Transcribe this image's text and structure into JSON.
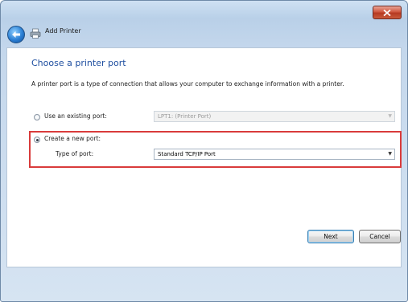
{
  "window": {
    "title": "Add Printer"
  },
  "page": {
    "heading": "Choose a printer port",
    "description": "A printer port is a type of connection that allows your computer to exchange information with a printer."
  },
  "options": {
    "existing": {
      "label": "Use an existing port:",
      "selected": false,
      "value": "LPT1: (Printer Port)"
    },
    "new_port": {
      "label": "Create a new port:",
      "selected": true,
      "type_label": "Type of port:",
      "type_value": "Standard TCP/IP Port"
    }
  },
  "buttons": {
    "next": "Next",
    "cancel": "Cancel"
  },
  "colors": {
    "highlight": "#d93b3b",
    "heading": "#1f4fa0"
  },
  "icons": {
    "close": "close-icon",
    "back": "back-arrow-icon",
    "printer": "printer-icon",
    "dropdown": "chevron-down-icon"
  }
}
